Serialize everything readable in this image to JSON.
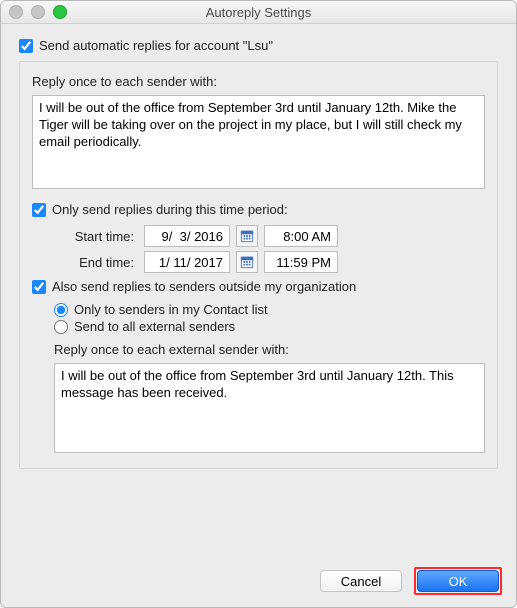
{
  "window": {
    "title": "Autoreply Settings"
  },
  "master_checkbox": {
    "checked": true,
    "label": "Send automatic replies for account \"Lsu\""
  },
  "internal": {
    "label": "Reply once to each sender with:",
    "message": "I will be out of the office from September 3rd until January 12th. Mike the Tiger will be taking over on the project in my place, but I will still check my email periodically."
  },
  "time_period": {
    "checked": true,
    "label": "Only send replies during this time period:",
    "start_label": "Start time:",
    "start_date": "9/  3/ 2016",
    "start_time": "8:00 AM",
    "end_label": "End time:",
    "end_date": "1/ 11/ 2017",
    "end_time": "11:59 PM"
  },
  "external": {
    "checked": true,
    "label": "Also send replies to senders outside my organization",
    "radio_contacts": "Only to senders in my Contact list",
    "radio_all": "Send to all external senders",
    "radio_selected": "contacts",
    "reply_label": "Reply once to each external sender with:",
    "message": "I will be out of the office from September 3rd until January 12th. This message has been received. "
  },
  "buttons": {
    "cancel": "Cancel",
    "ok": "OK"
  }
}
